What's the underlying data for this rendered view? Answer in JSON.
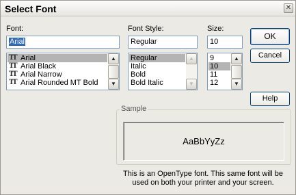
{
  "dialog": {
    "title": "Select Font",
    "close_glyph": "✕"
  },
  "font": {
    "label": "Font:",
    "value": "Arial",
    "items": [
      {
        "name": "Arial",
        "icon": "truetype-font-icon",
        "selected": true
      },
      {
        "name": "Arial Black",
        "icon": "truetype-font-icon"
      },
      {
        "name": "Arial Narrow",
        "icon": "truetype-font-icon"
      },
      {
        "name": "Arial Rounded MT Bold",
        "icon": "truetype-font-icon"
      }
    ]
  },
  "font_style": {
    "label": "Font Style:",
    "value": "Regular",
    "items": [
      "Regular",
      "Italic",
      "Bold",
      "Bold Italic"
    ],
    "selected": "Regular"
  },
  "size": {
    "label": "Size:",
    "value": "10",
    "items": [
      "9",
      "10",
      "11",
      "12"
    ],
    "selected": "10"
  },
  "buttons": {
    "ok": "OK",
    "cancel": "Cancel",
    "help": "Help"
  },
  "sample": {
    "legend": "Sample",
    "text": "AaBbYyZz"
  },
  "info": {
    "line1": "This is an OpenType font. This same font will be",
    "line2": "used on both your printer and your screen."
  },
  "icons": {
    "scroll_up": "▲",
    "scroll_down": "▼",
    "truetype": "TT"
  },
  "colors": {
    "dialog_bg": "#ebeae5",
    "selection": "#316ac5",
    "list_selected": "#b4b4b4",
    "field_border": "#7f9db9"
  }
}
